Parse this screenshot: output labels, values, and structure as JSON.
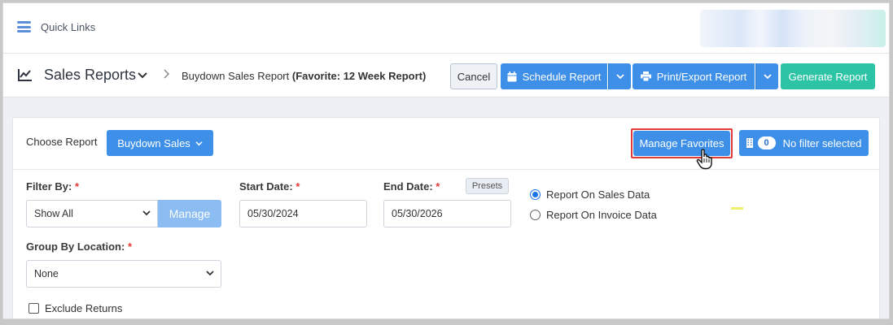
{
  "topbar": {
    "quick_links_label": "Quick Links"
  },
  "header": {
    "title": "Sales Reports",
    "breadcrumb_report": "Buydown Sales Report ",
    "breadcrumb_favorite": "(Favorite: 12 Week Report)",
    "buttons": {
      "cancel": "Cancel",
      "schedule": "Schedule Report",
      "print_export": "Print/Export Report",
      "generate": "Generate Report"
    }
  },
  "panel": {
    "choose_report_label": "Choose Report",
    "choose_report_value": "Buydown Sales",
    "manage_favorites": "Manage Favorites",
    "filter_count": "0",
    "no_filter_label": "No filter selected",
    "filter_by_label": "Filter By:",
    "filter_by_value": "Show All",
    "manage_button": "Manage",
    "start_date_label": "Start Date:",
    "start_date_value": "05/30/2024",
    "end_date_label": "End Date:",
    "end_date_value": "05/30/2026",
    "presets_button": "Presets",
    "radio_sales": "Report On Sales Data",
    "radio_invoice": "Report On Invoice Data",
    "group_by_label": "Group By Location:",
    "group_by_value": "None",
    "exclude_returns": "Exclude Returns",
    "required_mark": "*"
  },
  "colors": {
    "primary": "#3d8fe8",
    "teal": "#2dc3a5",
    "highlight_border": "#e53935"
  }
}
